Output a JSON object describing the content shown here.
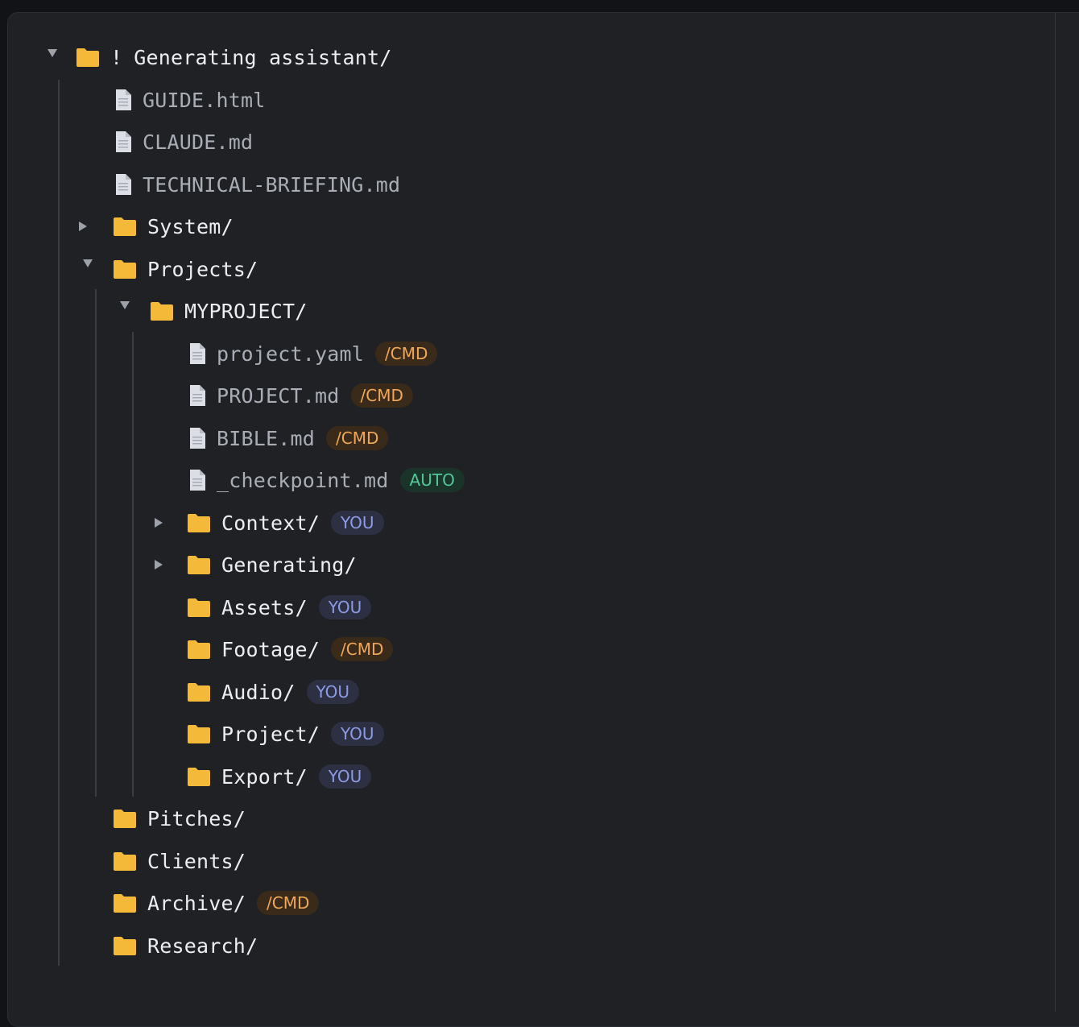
{
  "tree": {
    "root": {
      "prefix": "!",
      "label": "Generating assistant/"
    },
    "root_files": [
      {
        "label": "GUIDE.html"
      },
      {
        "label": "CLAUDE.md"
      },
      {
        "label": "TECHNICAL-BRIEFING.md"
      }
    ],
    "system": {
      "label": "System/"
    },
    "projects": {
      "label": "Projects/"
    },
    "myproject": {
      "label": "MYPROJECT/"
    },
    "myproject_files": [
      {
        "label": "project.yaml",
        "badge": "/CMD"
      },
      {
        "label": "PROJECT.md",
        "badge": "/CMD"
      },
      {
        "label": "BIBLE.md",
        "badge": "/CMD"
      },
      {
        "label": "_checkpoint.md",
        "badge": "AUTO"
      }
    ],
    "myproject_folders": [
      {
        "label": "Context/",
        "badge": "YOU"
      },
      {
        "label": "Generating/",
        "badge": ""
      },
      {
        "label": "Assets/",
        "badge": "YOU"
      },
      {
        "label": "Footage/",
        "badge": "/CMD"
      },
      {
        "label": "Audio/",
        "badge": "YOU"
      },
      {
        "label": "Project/",
        "badge": "YOU"
      },
      {
        "label": "Export/",
        "badge": "YOU"
      }
    ],
    "top_folders": [
      {
        "label": "Pitches/",
        "badge": ""
      },
      {
        "label": "Clients/",
        "badge": ""
      },
      {
        "label": "Archive/",
        "badge": "/CMD"
      },
      {
        "label": "Research/",
        "badge": ""
      }
    ]
  },
  "colors": {
    "folder": "#f5b93a",
    "cmd_badge": "#f0a75a",
    "you_badge": "#8d9ae6",
    "auto_badge": "#52c79a"
  }
}
